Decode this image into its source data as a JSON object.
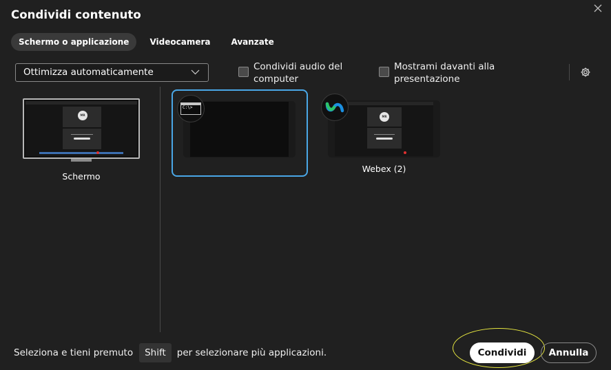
{
  "window": {
    "title": "Condividi contenuto"
  },
  "tabs": [
    {
      "label": "Schermo o applicazione",
      "active": true
    },
    {
      "label": "Videocamera",
      "active": false
    },
    {
      "label": "Avanzate",
      "active": false
    }
  ],
  "toolbar": {
    "optimize_value": "Ottimizza automaticamente",
    "share_audio_line1": "Condividi audio del",
    "share_audio_line2": "computer",
    "share_audio_checked": false,
    "show_in_front_line1": "Mostrami davanti alla",
    "show_in_front_line2": "presentazione",
    "show_in_front_checked": false
  },
  "screens": [
    {
      "label": "Schermo"
    }
  ],
  "thumbnail_text": {
    "avatar_initials": "MR"
  },
  "applications": [
    {
      "label": "",
      "icon": "command-prompt-icon",
      "icon_text": "C:\\>",
      "selected": true
    },
    {
      "label": "Webex (2)",
      "icon": "webex-icon",
      "selected": false
    }
  ],
  "footer": {
    "hint_before": "Seleziona e tieni premuto",
    "hint_key": "Shift",
    "hint_after": "per selezionare più applicazioni.",
    "share_label": "Condividi",
    "cancel_label": "Annulla"
  },
  "colors": {
    "background": "#202020",
    "selection_border": "#4aa8e8",
    "highlight": "#e8e840",
    "primary_button": "#ffffff"
  }
}
